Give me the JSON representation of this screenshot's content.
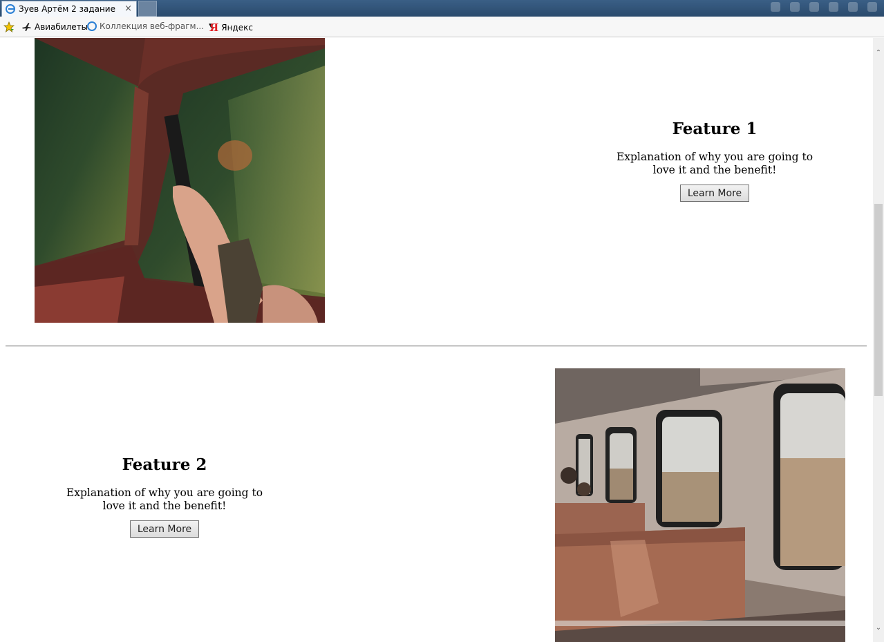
{
  "browser": {
    "tab_title": "Зуев Артём 2 задание",
    "tab_close": "×",
    "favorites": [
      {
        "label": "Авиабилеты",
        "icon": "airplane-icon"
      },
      {
        "label": "Коллекция веб-фрагм...",
        "icon": "ie-icon",
        "has_dropdown": true
      },
      {
        "label": "Яндекс",
        "icon": "yandex-icon"
      }
    ]
  },
  "features": [
    {
      "title": "Feature 1",
      "description": "Explanation of why you are going to love it and the benefit!",
      "button": "Learn More",
      "image": "truck-window-photo"
    },
    {
      "title": "Feature 2",
      "description": "Explanation of why you are going to love it and the benefit!",
      "button": "Learn More",
      "image": "train-interior-photo"
    }
  ],
  "colors": {
    "titlebar": "#2f5478",
    "favbar": "#f7f7f7",
    "page_bg": "#ffffff",
    "rule": "#8a8a8a"
  }
}
